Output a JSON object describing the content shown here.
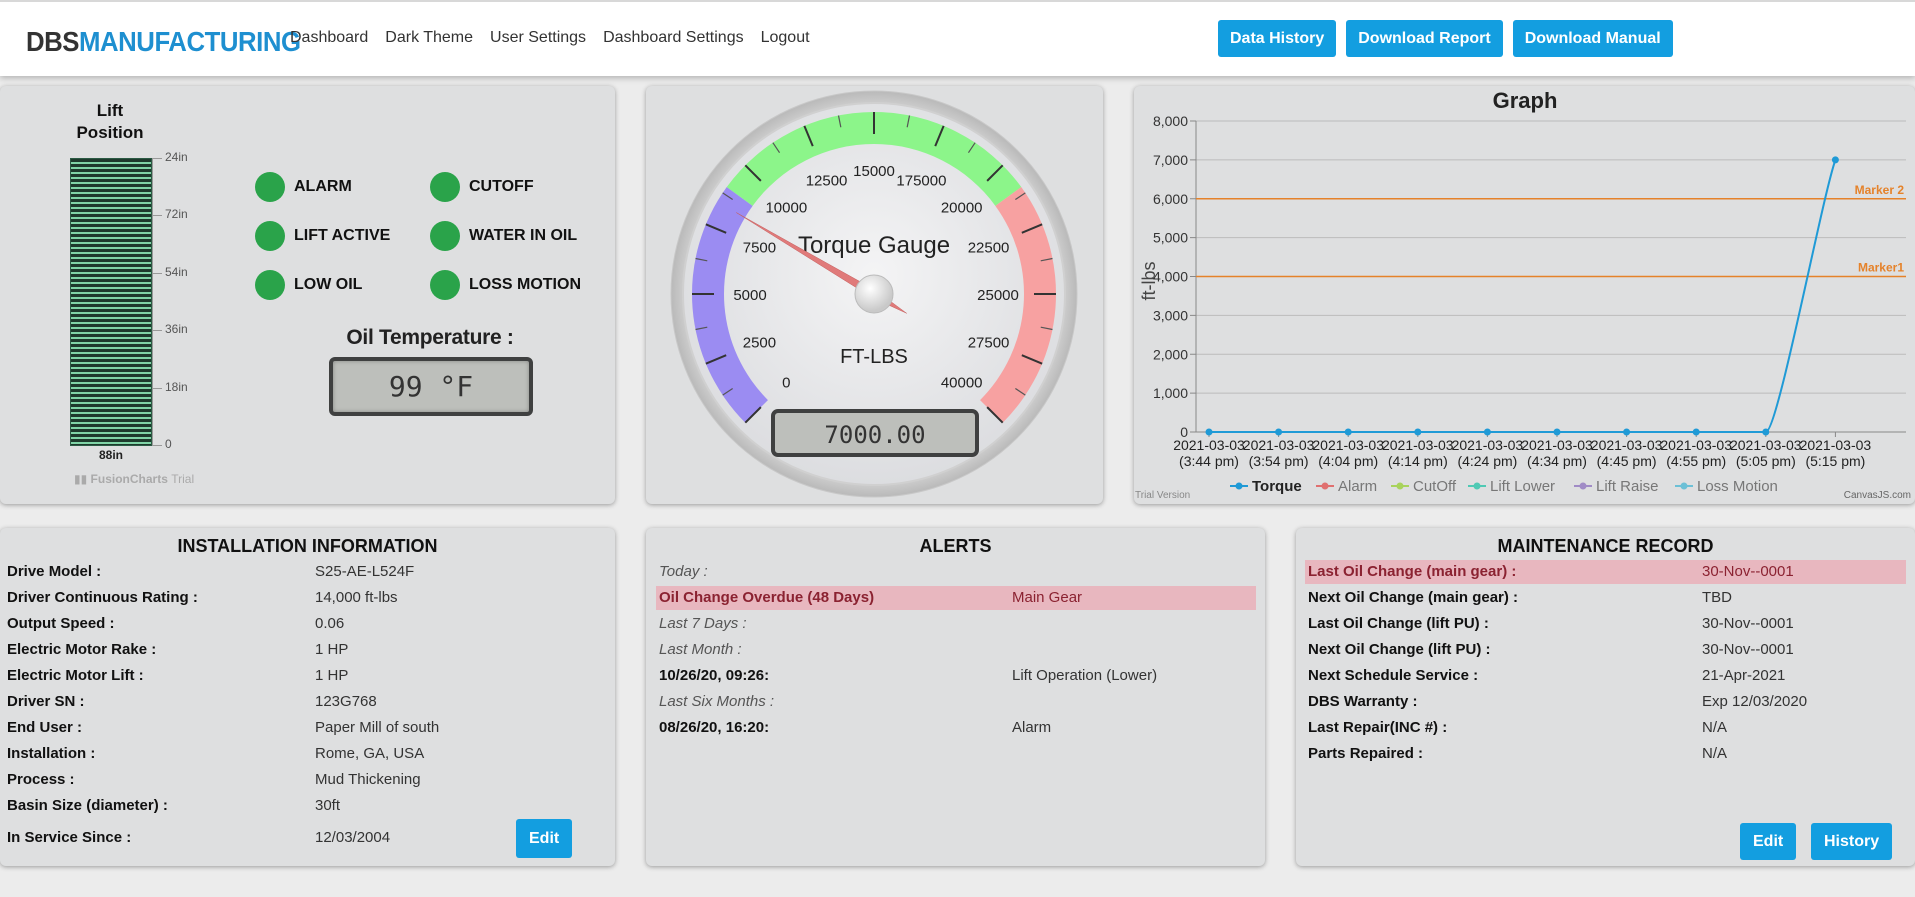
{
  "header": {
    "logo_part1": "DBS",
    "logo_part2": "MANUFACTURING",
    "nav": [
      "Dashboard",
      "Dark Theme",
      "User Settings",
      "Dashboard Settings",
      "Logout"
    ],
    "buttons": [
      "Data History",
      "Download Report",
      "Download Manual"
    ]
  },
  "lift": {
    "title_line1": "Lift",
    "title_line2": "Position",
    "ticks": [
      "24in",
      "72in",
      "54in",
      "36in",
      "18in",
      "0"
    ],
    "current": "88in",
    "trial_brand": "FusionCharts",
    "trial_suffix": "Trial"
  },
  "indicators": [
    "ALARM",
    "CUTOFF",
    "LIFT ACTIVE",
    "WATER IN OIL",
    "LOW OIL",
    "LOSS MOTION"
  ],
  "indicator_color": "#2aa34a",
  "oil": {
    "title": "Oil Temperature :",
    "value": "99 °F"
  },
  "gauge": {
    "title": "Torque Gauge",
    "unit": "FT-LBS",
    "readout": "7000.00",
    "scale_labels": [
      "0",
      "2500",
      "5000",
      "7500",
      "10000",
      "12500",
      "15000",
      "175000",
      "20000",
      "22500",
      "25000",
      "27500",
      "40000"
    ],
    "needle_fraction": 0.28,
    "band_colors": [
      "#9b8cf2",
      "#8cf58a",
      "#f7a1a1"
    ]
  },
  "graph": {
    "title": "Graph",
    "trial_text": "Trial Version",
    "credit": "CanvasJS.com",
    "marker_colors": [
      "#e5822a"
    ],
    "legend_colors": [
      "#1f9ad6",
      "#e07070",
      "#a8d35c",
      "#4fc9b4",
      "#a08bc6",
      "#6cc0d6"
    ]
  },
  "chart_data": {
    "type": "line",
    "title": "Graph",
    "ylabel": "ft-lbs",
    "xlabel": "",
    "ylim": [
      0,
      8000
    ],
    "y_ticks": [
      "0",
      "1,000",
      "2,000",
      "3,000",
      "4,000",
      "5,000",
      "6,000",
      "7,000",
      "8,000"
    ],
    "x_ticks": [
      [
        "2021-03-03",
        "(3:44 pm)"
      ],
      [
        "2021-03-03",
        "(3:54 pm)"
      ],
      [
        "2021-03-03",
        "(4:04 pm)"
      ],
      [
        "2021-03-03",
        "(4:14 pm)"
      ],
      [
        "2021-03-03",
        "(4:24 pm)"
      ],
      [
        "2021-03-03",
        "(4:34 pm)"
      ],
      [
        "2021-03-03",
        "(4:45 pm)"
      ],
      [
        "2021-03-03",
        "(4:55 pm)"
      ],
      [
        "2021-03-03",
        "(5:05 pm)"
      ],
      [
        "2021-03-03",
        "(5:15 pm)"
      ]
    ],
    "series": [
      {
        "name": "Torque",
        "values": [
          0,
          0,
          0,
          0,
          0,
          0,
          0,
          0,
          0,
          7000
        ]
      },
      {
        "name": "Alarm",
        "values": []
      },
      {
        "name": "CutOff",
        "values": []
      },
      {
        "name": "Lift Lower",
        "values": []
      },
      {
        "name": "Lift Raise",
        "values": []
      },
      {
        "name": "Loss Motion",
        "values": []
      }
    ],
    "markers": [
      {
        "name": "Marker 2",
        "value": 6000
      },
      {
        "name": "Marker1",
        "value": 4000
      }
    ],
    "grid": true,
    "legend": "bottom"
  },
  "installation": {
    "title": "INSTALLATION INFORMATION",
    "rows": [
      {
        "label": "Drive Model :",
        "value": "S25-AE-L524F"
      },
      {
        "label": "Driver Continuous Rating :",
        "value": "14,000 ft-lbs"
      },
      {
        "label": "Output Speed :",
        "value": "0.06"
      },
      {
        "label": "Electric Motor Rake :",
        "value": "1 HP"
      },
      {
        "label": "Electric Motor Lift :",
        "value": "1 HP"
      },
      {
        "label": "Driver SN :",
        "value": "123G768"
      },
      {
        "label": "End User :",
        "value": "Paper Mill of south"
      },
      {
        "label": "Installation :",
        "value": "Rome, GA, USA"
      },
      {
        "label": "Process :",
        "value": "Mud Thickening"
      },
      {
        "label": "Basin Size (diameter) :",
        "value": "30ft"
      },
      {
        "label": "In Service Since :",
        "value": "12/03/2004"
      }
    ],
    "edit": "Edit"
  },
  "alerts": {
    "title": "ALERTS",
    "rows": [
      {
        "label": "Today :",
        "value": ""
      },
      {
        "label": "Oil Change Overdue (48 Days)",
        "value": "Main Gear"
      },
      {
        "label": "Last 7 Days :",
        "value": ""
      },
      {
        "label": "Last Month :",
        "value": ""
      },
      {
        "label": "10/26/20, 09:26:",
        "value": "Lift Operation (Lower)"
      },
      {
        "label": "Last Six Months :",
        "value": ""
      },
      {
        "label": "08/26/20, 16:20:",
        "value": "Alarm"
      }
    ]
  },
  "maintenance": {
    "title": "MAINTENANCE RECORD",
    "rows": [
      {
        "label": "Last Oil Change (main gear) :",
        "value": "30-Nov--0001"
      },
      {
        "label": "Next Oil Change (main gear) :",
        "value": "TBD"
      },
      {
        "label": "Last Oil Change (lift PU) :",
        "value": "30-Nov--0001"
      },
      {
        "label": "Next Oil Change (lift PU) :",
        "value": "30-Nov--0001"
      },
      {
        "label": "Next Schedule Service :",
        "value": "21-Apr-2021"
      },
      {
        "label": "DBS Warranty :",
        "value": "Exp 12/03/2020"
      },
      {
        "label": "Last Repair(INC #) :",
        "value": "N/A"
      },
      {
        "label": "Parts Repaired :",
        "value": "N/A"
      }
    ],
    "edit": "Edit",
    "history": "History"
  }
}
